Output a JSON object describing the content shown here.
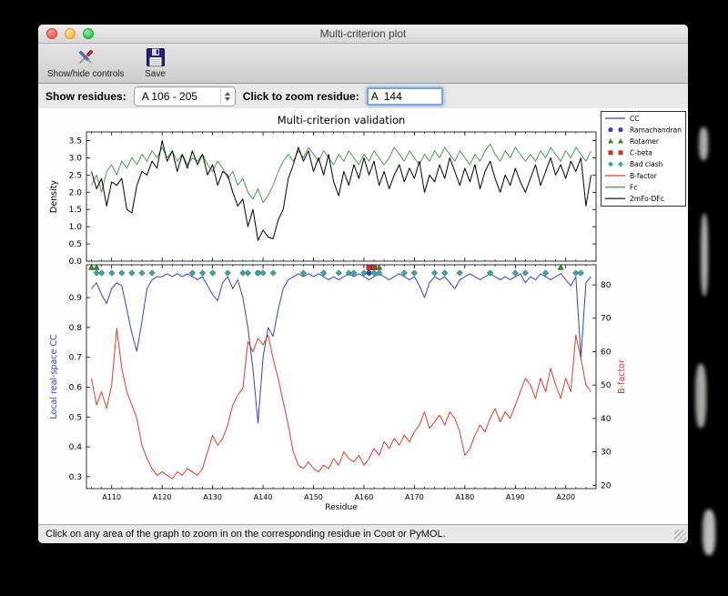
{
  "window": {
    "title": "Multi-criterion plot",
    "toolbar": {
      "show_hide_label": "Show/hide controls",
      "save_label": "Save"
    },
    "controls": {
      "show_residues_label": "Show residues:",
      "residue_range_value": "A 106 - 205",
      "zoom_residue_label": "Click to zoom residue:",
      "zoom_residue_value": "A  144"
    },
    "status_text": "Click on any area of the graph to zoom in on the corresponding residue in Coot or PyMOL."
  },
  "chart_data": {
    "type": "line",
    "title": "Multi-criterion validation",
    "xlabel": "Residue",
    "x_start": 106,
    "x_end": 205,
    "xlim": [
      105,
      206
    ],
    "x_ticks": [
      "A110",
      "A120",
      "A130",
      "A140",
      "A150",
      "A160",
      "A170",
      "A180",
      "A190",
      "A200"
    ],
    "x_tick_values": [
      110,
      120,
      130,
      140,
      150,
      160,
      170,
      180,
      190,
      200
    ],
    "top_panel": {
      "ylabel": "Density",
      "ylim": [
        0,
        3.75
      ],
      "yticks": [
        0.0,
        0.5,
        1.0,
        1.5,
        2.0,
        2.5,
        3.0,
        3.5
      ],
      "series": [
        {
          "name": "Fc",
          "color": "#4c9b4c",
          "values": [
            2.2,
            2.5,
            2.0,
            2.6,
            2.8,
            2.5,
            2.9,
            2.7,
            3.0,
            2.8,
            3.1,
            2.9,
            3.2,
            3.0,
            3.3,
            3.0,
            3.2,
            2.9,
            3.1,
            2.8,
            3.0,
            2.9,
            3.1,
            2.8,
            2.6,
            2.9,
            2.7,
            2.4,
            2.6,
            2.2,
            2.4,
            2.0,
            1.8,
            2.1,
            1.7,
            1.9,
            2.2,
            2.6,
            2.9,
            3.1,
            2.9,
            3.2,
            3.0,
            3.3,
            3.1,
            2.9,
            3.2,
            3.0,
            2.8,
            3.1,
            2.9,
            3.2,
            3.0,
            2.8,
            3.1,
            2.9,
            3.2,
            3.0,
            2.8,
            3.0,
            3.3,
            3.1,
            2.9,
            3.2,
            3.0,
            2.8,
            3.1,
            2.9,
            3.2,
            3.0,
            3.3,
            3.1,
            2.9,
            3.2,
            3.0,
            2.8,
            3.1,
            2.9,
            3.2,
            3.4,
            3.1,
            2.9,
            3.2,
            3.0,
            3.3,
            3.1,
            2.9,
            3.1,
            2.9,
            3.2,
            3.0,
            3.3,
            3.1,
            2.9,
            3.2,
            3.0,
            3.3,
            3.1,
            2.9,
            3.2
          ]
        },
        {
          "name": "2mFo-DFc",
          "color": "#000000",
          "values": [
            2.6,
            2.1,
            2.4,
            1.6,
            2.3,
            2.2,
            2.4,
            1.5,
            1.4,
            2.2,
            2.6,
            2.5,
            2.9,
            2.7,
            3.5,
            2.9,
            3.2,
            2.6,
            3.1,
            2.7,
            3.2,
            2.8,
            3.1,
            2.5,
            2.8,
            2.2,
            2.6,
            2.5,
            2.0,
            1.6,
            1.8,
            1.0,
            1.5,
            0.6,
            0.9,
            0.7,
            0.65,
            1.2,
            1.5,
            2.4,
            2.8,
            3.3,
            2.9,
            3.2,
            2.6,
            3.0,
            2.5,
            3.1,
            2.3,
            1.9,
            2.6,
            2.2,
            2.8,
            2.4,
            3.0,
            2.5,
            2.9,
            2.2,
            2.6,
            2.1,
            2.5,
            2.8,
            2.3,
            2.7,
            2.4,
            2.9,
            2.0,
            2.5,
            2.3,
            2.8,
            2.4,
            3.0,
            2.6,
            2.2,
            2.7,
            2.3,
            2.8,
            2.1,
            2.6,
            2.9,
            2.4,
            2.0,
            2.5,
            2.2,
            2.7,
            2.3,
            2.0,
            2.4,
            2.8,
            2.2,
            2.6,
            3.0,
            2.5,
            2.8,
            2.4,
            2.9,
            2.6,
            3.0,
            1.6,
            2.5
          ]
        }
      ]
    },
    "bottom_panel": {
      "ylabel_left": "Local real-space CC",
      "ylabel_left_color": "#3344cc",
      "ylabel_right": "B-factor",
      "ylabel_right_color": "#e03a2f",
      "ylim_left": [
        0.26,
        1.01
      ],
      "yticks_left": [
        0.3,
        0.4,
        0.5,
        0.6,
        0.7,
        0.8,
        0.9
      ],
      "ylim_right": [
        19,
        86
      ],
      "yticks_right": [
        20,
        30,
        40,
        50,
        60,
        70,
        80
      ],
      "series": [
        {
          "name": "CC",
          "axis": "left",
          "color": "#3344cc",
          "values": [
            0.93,
            0.95,
            0.91,
            0.88,
            0.93,
            0.95,
            0.94,
            0.86,
            0.78,
            0.72,
            0.82,
            0.93,
            0.96,
            0.97,
            0.97,
            0.98,
            0.97,
            0.98,
            0.97,
            0.98,
            0.97,
            0.96,
            0.97,
            0.94,
            0.91,
            0.89,
            0.95,
            0.97,
            0.93,
            0.96,
            0.9,
            0.8,
            0.66,
            0.48,
            0.7,
            0.8,
            0.77,
            0.86,
            0.93,
            0.96,
            0.97,
            0.98,
            0.97,
            0.98,
            0.97,
            0.98,
            0.97,
            0.96,
            0.97,
            0.96,
            0.97,
            0.98,
            0.97,
            0.98,
            0.97,
            0.96,
            0.97,
            0.98,
            0.97,
            0.96,
            0.97,
            0.98,
            0.97,
            0.96,
            0.97,
            0.94,
            0.9,
            0.95,
            0.97,
            0.96,
            0.97,
            0.95,
            0.93,
            0.96,
            0.97,
            0.98,
            0.97,
            0.96,
            0.97,
            0.98,
            0.97,
            0.96,
            0.97,
            0.96,
            0.97,
            0.98,
            0.95,
            0.97,
            0.96,
            0.98,
            0.97,
            0.96,
            0.97,
            0.98,
            0.96,
            0.94,
            0.97,
            0.7,
            0.95,
            0.97
          ]
        },
        {
          "name": "B-factor",
          "axis": "right",
          "color": "#e03a2f",
          "values": [
            52,
            44,
            48,
            43,
            50,
            67,
            55,
            48,
            44,
            40,
            32,
            28,
            25,
            23,
            24,
            23,
            22,
            24,
            23,
            25,
            24,
            23,
            25,
            30,
            35,
            32,
            34,
            38,
            44,
            47,
            49,
            63,
            60,
            64,
            62,
            65,
            58,
            52,
            45,
            38,
            30,
            26,
            25,
            27,
            25,
            24,
            26,
            25,
            28,
            26,
            30,
            28,
            27,
            29,
            26,
            28,
            31,
            29,
            33,
            31,
            34,
            32,
            35,
            33,
            36,
            38,
            42,
            37,
            39,
            41,
            38,
            42,
            40,
            36,
            29,
            31,
            35,
            38,
            36,
            40,
            43,
            39,
            42,
            40,
            44,
            48,
            52,
            50,
            46,
            52,
            48,
            55,
            50,
            46,
            52,
            48,
            65,
            58,
            50,
            48
          ]
        }
      ],
      "markers": {
        "ramachandran": {
          "shape": "circle",
          "color": "#3344cc",
          "residues": [
            139,
            161
          ]
        },
        "rotamer": {
          "shape": "triangle",
          "color": "#2f8b2f",
          "residues": [
            106,
            107,
            163,
            199
          ]
        },
        "c_beta": {
          "shape": "square",
          "color": "#c0392b",
          "residues": [
            161,
            162
          ]
        },
        "bad_clash": {
          "shape": "diamond",
          "color": "#3ba59e",
          "residues": [
            107,
            108,
            110,
            112,
            114,
            116,
            118,
            126,
            128,
            130,
            133,
            136,
            137,
            139,
            140,
            142,
            148,
            152,
            155,
            157,
            158,
            160,
            162,
            163,
            168,
            170,
            174,
            176,
            179,
            185,
            190,
            192,
            196,
            202,
            203
          ]
        }
      }
    },
    "legend": [
      {
        "label": "CC",
        "type": "line",
        "color": "#3344cc"
      },
      {
        "label": "Ramachandran",
        "type": "circle",
        "color": "#3344cc"
      },
      {
        "label": "Rotamer",
        "type": "triangle",
        "color": "#2f8b2f"
      },
      {
        "label": "C-beta",
        "type": "square",
        "color": "#c0392b"
      },
      {
        "label": "Bad clash",
        "type": "diamond",
        "color": "#3ba59e"
      },
      {
        "label": "B-factor",
        "type": "line",
        "color": "#e03a2f"
      },
      {
        "label": "Fc",
        "type": "line",
        "color": "#4c9b4c"
      },
      {
        "label": "2mFo-DFc",
        "type": "line",
        "color": "#000000"
      }
    ]
  }
}
